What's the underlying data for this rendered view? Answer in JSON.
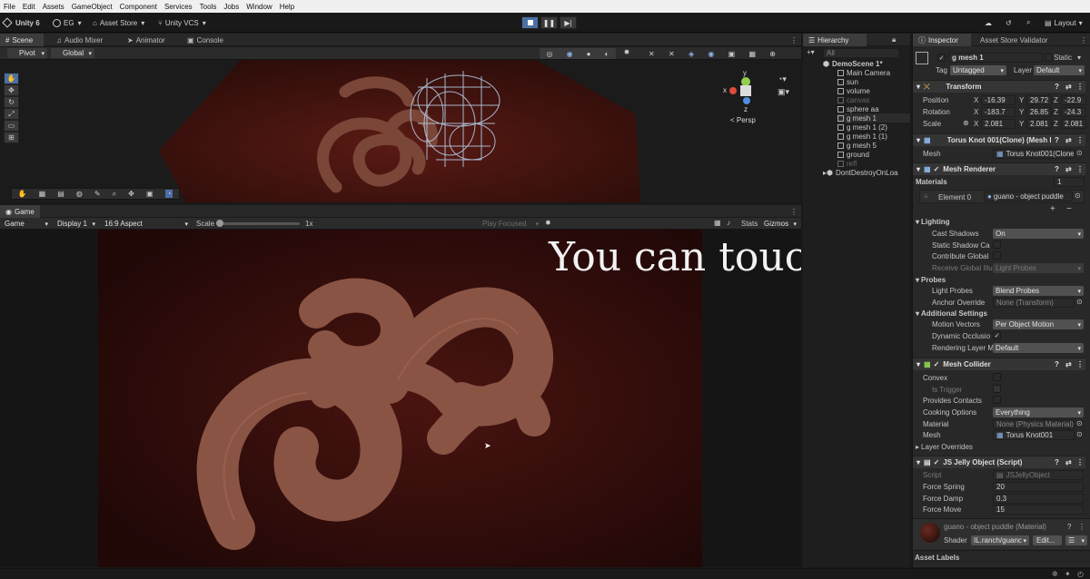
{
  "menubar": {
    "items": [
      "File",
      "Edit",
      "Assets",
      "GameObject",
      "Component",
      "Services",
      "Tools",
      "Jobs",
      "Window",
      "Help"
    ]
  },
  "toolbar": {
    "version": "Unity 6",
    "account": "EG",
    "asset_store": "Asset Store",
    "vcs": "Unity VCS",
    "layout": "Layout"
  },
  "scene_tabs": [
    "Scene",
    "Audio Mixer",
    "Animator",
    "Console"
  ],
  "scene": {
    "pivot": "Pivot",
    "global": "Global",
    "persp": "< Persp",
    "gizmo_y": "y",
    "gizmo_x": "x",
    "gizmo_z": "z"
  },
  "game": {
    "tab": "Game",
    "mode": "Game",
    "display": "Display 1",
    "aspect": "16:9 Aspect",
    "scale_label": "Scale",
    "scale_value": "1x",
    "play_focused": "Play Focused",
    "stats": "Stats",
    "gizmos": "Gizmos",
    "overlay_text": "You can touch this!!!"
  },
  "hierarchy": {
    "tab": "Hierarchy",
    "search": "All",
    "scene": "DemoScene 1*",
    "items": [
      {
        "name": "Main Camera",
        "dim": false
      },
      {
        "name": "sun",
        "dim": false
      },
      {
        "name": "volume",
        "dim": false
      },
      {
        "name": "canvas",
        "dim": true
      },
      {
        "name": "sphere aa",
        "dim": false
      },
      {
        "name": "g mesh 1",
        "dim": false
      },
      {
        "name": "g mesh 1 (2)",
        "dim": false
      },
      {
        "name": "g mesh 1 (1)",
        "dim": false
      },
      {
        "name": "g mesh 5",
        "dim": false
      },
      {
        "name": "ground",
        "dim": false
      },
      {
        "name": "refl",
        "dim": true
      }
    ],
    "dont_destroy": "DontDestroyOnLoa"
  },
  "inspector": {
    "tab": "Inspector",
    "tab2": "Asset Store Validator",
    "object_name": "g mesh 1",
    "static_label": "Static",
    "tag_label": "Tag",
    "tag_value": "Untagged",
    "layer_label": "Layer",
    "layer_value": "Default",
    "transform": {
      "title": "Transform",
      "position_label": "Position",
      "rotation_label": "Rotation",
      "scale_label": "Scale",
      "position": {
        "x": "-16.39",
        "y": "29.72",
        "z": "-22.9"
      },
      "rotation": {
        "x": "-183.7",
        "y": "26.85",
        "z": "-24.3"
      },
      "scale": {
        "x": "2.081",
        "y": "2.081",
        "z": "2.081"
      }
    },
    "mesh_filter": {
      "title": "Torus Knot 001(Clone) (Mesh F",
      "mesh_label": "Mesh",
      "mesh_value": "Torus Knot001(Clone)"
    },
    "mesh_renderer": {
      "title": "Mesh Renderer",
      "materials_label": "Materials",
      "materials_count": "1",
      "element0_label": "Element 0",
      "element0_value": "guano - object puddle",
      "lighting": "Lighting",
      "cast_shadows_label": "Cast Shadows",
      "cast_shadows_value": "On",
      "static_shadow_label": "Static Shadow Ca",
      "contribute_gi_label": "Contribute Global",
      "receive_gi_label": "Receive Global Illu",
      "receive_gi_value": "Light Probes",
      "probes": "Probes",
      "light_probes_label": "Light Probes",
      "light_probes_value": "Blend Probes",
      "anchor_label": "Anchor Override",
      "anchor_value": "None (Transform)",
      "additional": "Additional Settings",
      "motion_vectors_label": "Motion Vectors",
      "motion_vectors_value": "Per Object Motion",
      "dynamic_occlusion_label": "Dynamic Occlusio",
      "rendering_layer_label": "Rendering Layer M",
      "rendering_layer_value": "Default"
    },
    "mesh_collider": {
      "title": "Mesh Collider",
      "convex_label": "Convex",
      "is_trigger_label": "Is Trigger",
      "provides_contacts_label": "Provides Contacts",
      "cooking_label": "Cooking Options",
      "cooking_value": "Everything",
      "material_label": "Material",
      "material_value": "None (Physics Material)",
      "mesh_label": "Mesh",
      "mesh_value": "Torus Knot001",
      "layer_overrides": "Layer Overrides"
    },
    "jelly": {
      "title": "JS Jelly Object (Script)",
      "script_label": "Script",
      "script_value": "JSJellyObject",
      "force_spring_label": "Force Spring",
      "force_spring_value": "20",
      "force_damp_label": "Force Damp",
      "force_damp_value": "0.3",
      "force_move_label": "Force Move",
      "force_move_value": "15"
    },
    "material": {
      "name": "guano - object puddle (Material)",
      "shader_label": "Shader",
      "shader_value": "IL.ranch/guanc",
      "edit_label": "Edit..."
    },
    "asset_labels": "Asset Labels"
  },
  "colors": {
    "accent": "#4a6fa5",
    "scene_floor": "#4a1410",
    "game_floor": "#3a0f0c",
    "knot": "#8a4a3c",
    "wire": "#b8d4ee"
  }
}
